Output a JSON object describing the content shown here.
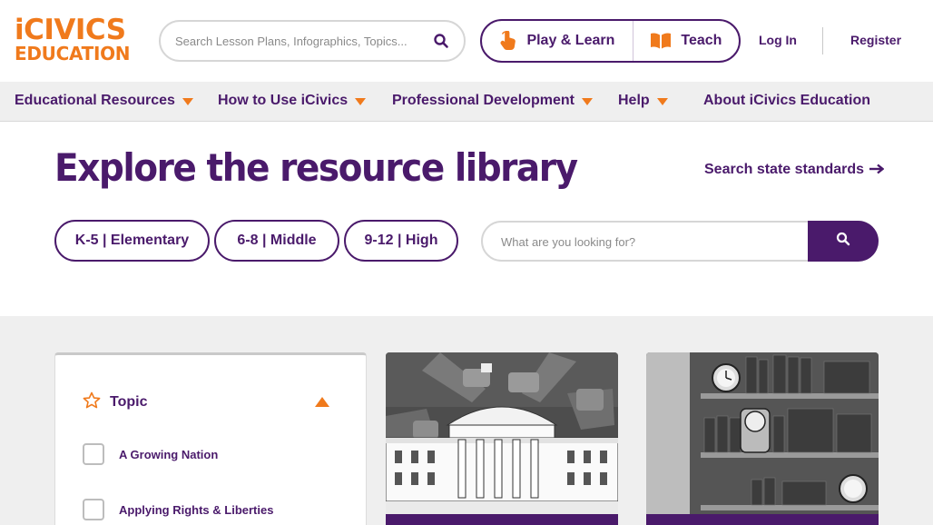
{
  "header": {
    "logo": {
      "line1": "iCIVICS",
      "line2": "EDUCATION"
    },
    "search": {
      "placeholder": "Search Lesson Plans, Infographics, Topics..."
    },
    "play_learn_label": "Play & Learn",
    "teach_label": "Teach",
    "login_label": "Log In",
    "register_label": "Register"
  },
  "nav": {
    "items": [
      {
        "label": "Educational Resources",
        "has_dropdown": true
      },
      {
        "label": "How to Use iCivics",
        "has_dropdown": true
      },
      {
        "label": "Professional Development",
        "has_dropdown": true
      },
      {
        "label": "Help",
        "has_dropdown": true
      },
      {
        "label": "About iCivics Education",
        "has_dropdown": false
      }
    ]
  },
  "hero": {
    "title": "Explore the resource library",
    "state_standards_label": "Search state standards",
    "grade_buttons": [
      "K-5 | Elementary",
      "6-8 | Middle",
      "9-12 | High"
    ],
    "library_search": {
      "placeholder": "What are you looking for?"
    }
  },
  "filters": {
    "topic_label": "Topic",
    "topic_expanded": true,
    "options": [
      {
        "label": "A Growing Nation",
        "checked": false
      },
      {
        "label": "Applying Rights & Liberties",
        "checked": false
      }
    ]
  },
  "cards": [
    {
      "image": "white-house-voting-illustration"
    },
    {
      "image": "bookshelf-clocks-illustration"
    }
  ],
  "colors": {
    "brand_purple": "#4a1a6b",
    "brand_orange": "#f07a1c",
    "nav_bg": "#efefef",
    "section_bg": "#efefef"
  },
  "icons": [
    "search-icon",
    "hand-pointer-icon",
    "open-book-icon",
    "caret-down-icon",
    "caret-up-icon",
    "star-outline-icon",
    "arrow-right-icon"
  ]
}
